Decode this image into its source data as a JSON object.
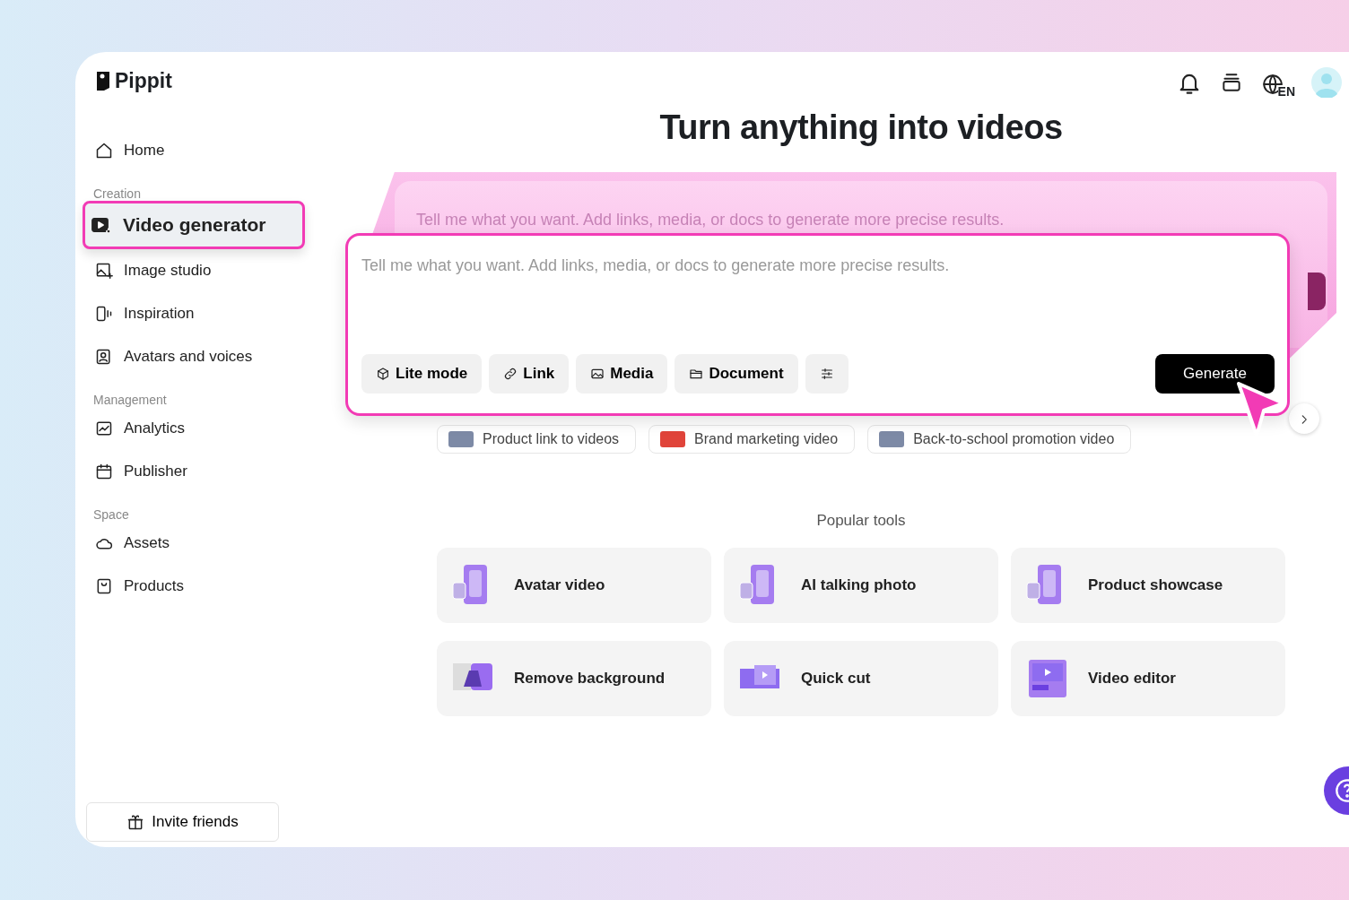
{
  "brand": {
    "name": "Pippit"
  },
  "header": {
    "language": "EN"
  },
  "sidebar": {
    "items": [
      {
        "label": "Home",
        "selected": false
      }
    ],
    "sections": [
      {
        "title": "Creation",
        "items": [
          {
            "label": "Video generator",
            "selected": true
          },
          {
            "label": "Image studio",
            "selected": false
          },
          {
            "label": "Inspiration",
            "selected": false
          },
          {
            "label": "Avatars and voices",
            "selected": false
          }
        ]
      },
      {
        "title": "Management",
        "items": [
          {
            "label": "Analytics",
            "selected": false
          },
          {
            "label": "Publisher",
            "selected": false
          }
        ]
      },
      {
        "title": "Space",
        "items": [
          {
            "label": "Assets",
            "selected": false
          },
          {
            "label": "Products",
            "selected": false
          }
        ]
      }
    ],
    "invite": {
      "label": "Invite friends"
    }
  },
  "main": {
    "title": "Turn anything into videos",
    "back_panel": {
      "placeholder": "Tell me what you want. Add links, media, or docs to generate more precise results."
    },
    "prompt": {
      "placeholder": "Tell me what you want. Add links, media, or docs to generate more precise results.",
      "tools": [
        {
          "kind": "lite",
          "label": "Lite mode"
        },
        {
          "kind": "link",
          "label": "Link"
        },
        {
          "kind": "media",
          "label": "Media"
        },
        {
          "kind": "document",
          "label": "Document"
        },
        {
          "kind": "settings"
        }
      ],
      "generate": "Generate"
    },
    "suggestions": [
      {
        "label": "Product link to videos"
      },
      {
        "label": "Brand marketing video"
      },
      {
        "label": "Back-to-school promotion video"
      }
    ],
    "popular_tools": {
      "title": "Popular tools",
      "tools": [
        {
          "label": "Avatar video"
        },
        {
          "label": "AI talking photo"
        },
        {
          "label": "Product showcase"
        },
        {
          "label": "Remove background"
        },
        {
          "label": "Quick cut"
        },
        {
          "label": "Video editor"
        }
      ]
    }
  }
}
